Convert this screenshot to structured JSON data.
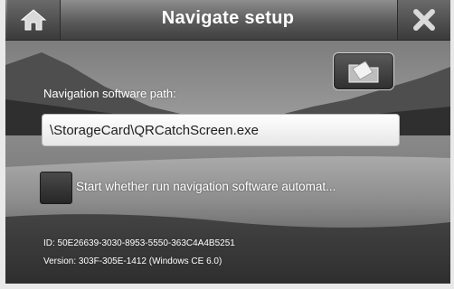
{
  "header": {
    "title": "Navigate setup",
    "home_icon": "home-icon",
    "close_icon": "close-icon"
  },
  "navigation": {
    "path_label": "Navigation software path:",
    "path_value": "\\StorageCard\\QRCatchScreen.exe",
    "browse_icon": "folder-icon"
  },
  "autostart": {
    "label": "Start whether run navigation software automat...",
    "checked": false
  },
  "device_info": {
    "id": "ID: 50E26639-3030-8953-5550-363C4A4B5251",
    "version": "Version: 303F-305E-1412 (Windows CE 6.0)"
  },
  "colors": {
    "title_text": "#ffffff",
    "field_background": "#ffffff",
    "titlebar": "#4a4a4a"
  }
}
